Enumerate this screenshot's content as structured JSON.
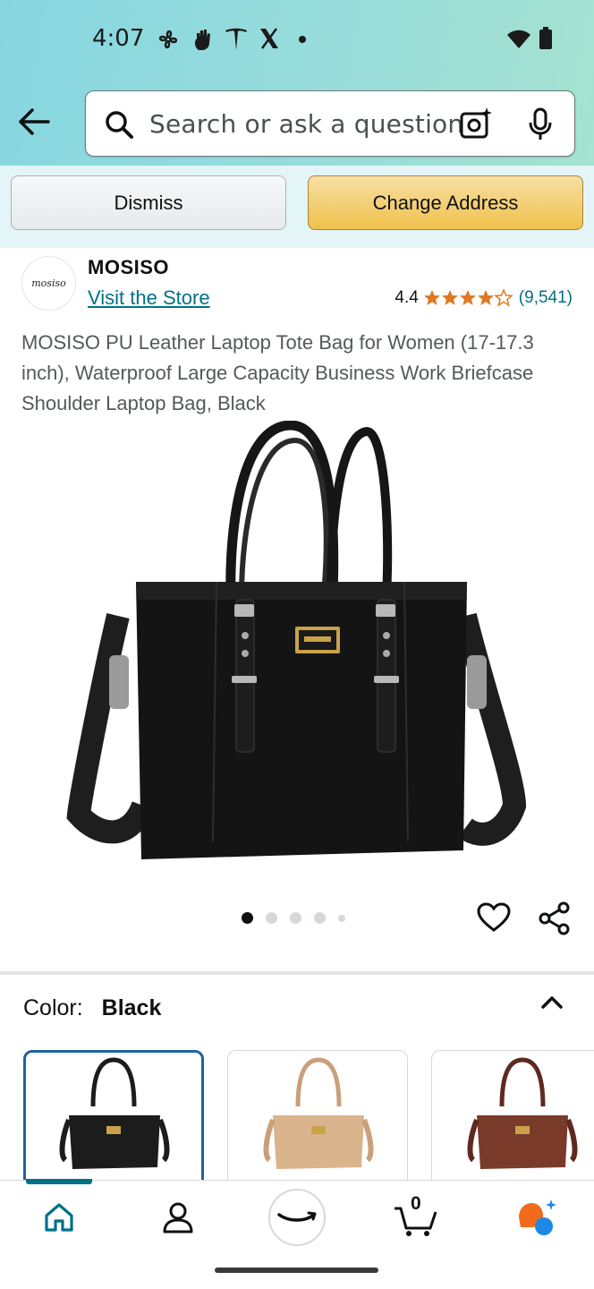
{
  "status_bar": {
    "time": "4:07",
    "icons": [
      "pinwheel-icon",
      "hand-icon",
      "tesla-icon",
      "x-icon",
      "dot-icon",
      "wifi-icon",
      "battery-icon"
    ]
  },
  "search": {
    "placeholder": "Search or ask a question"
  },
  "address_bar": {
    "dismiss_label": "Dismiss",
    "change_label": "Change Address"
  },
  "product": {
    "brand_logo_text": "mosiso",
    "brand": "MOSISO",
    "visit_store": "Visit the Store",
    "rating": "4.4",
    "rating_value": 4.4,
    "rating_count": "(9,541)",
    "title": "MOSISO PU Leather Laptop Tote Bag for Women (17-17.3 inch), Waterproof Large Capacity Business Work Briefcase Shoulder Laptop Bag, Black",
    "image_count": 5,
    "active_image": 1
  },
  "variant": {
    "label": "Color:",
    "selected": "Black",
    "swatches": [
      "Black",
      "Khaki",
      "Brown"
    ],
    "swatch_colors": [
      "#1c1c1c",
      "#d9b48c",
      "#7a3a2a"
    ]
  },
  "bottom_nav": {
    "items": [
      "home-icon",
      "account-icon",
      "amazon-icon",
      "cart-icon",
      "rufus-icon"
    ],
    "cart_count": "0",
    "active": "home"
  },
  "colors": {
    "accent_teal": "#007185",
    "star_orange": "#de7921",
    "button_yellow": "#f0c14b",
    "selected_border": "#2162a1"
  }
}
